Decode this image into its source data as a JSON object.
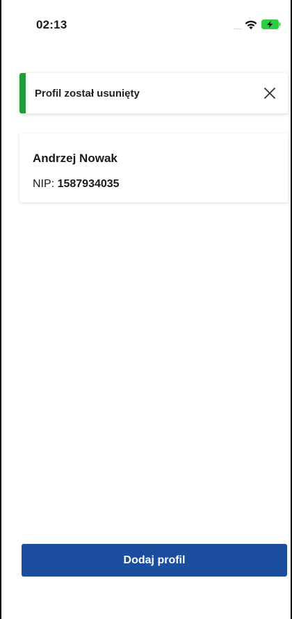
{
  "status_bar": {
    "time": "02:13",
    "signal_dots": "·····",
    "icons": [
      "wifi-icon",
      "battery-charging-icon"
    ]
  },
  "toast": {
    "message": "Profil został usunięty",
    "accent_color": "#1f9e3a",
    "close_icon": "close-icon"
  },
  "profiles": [
    {
      "name": "Andrzej Nowak",
      "nip_label": "NIP:",
      "nip_value": "1587934035"
    }
  ],
  "actions": {
    "add_profile_label": "Dodaj profil",
    "button_color": "#1c4ea0"
  }
}
